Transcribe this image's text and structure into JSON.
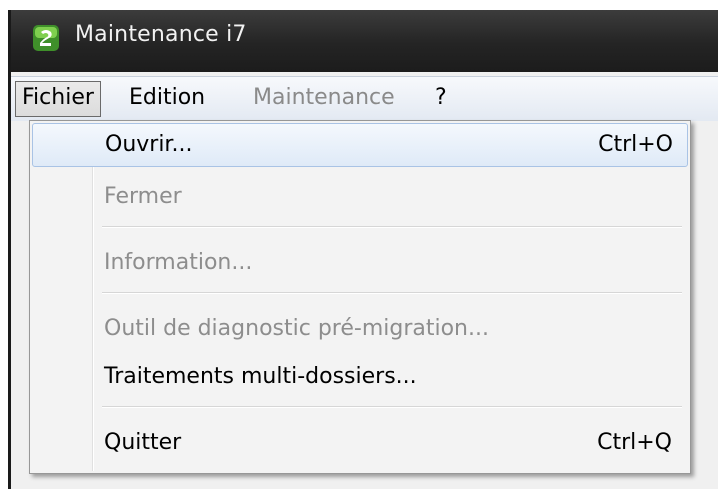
{
  "window": {
    "title": "Maintenance i7"
  },
  "menubar": {
    "items": [
      {
        "label": "Fichier"
      },
      {
        "label": "Edition"
      },
      {
        "label": "Maintenance"
      },
      {
        "label": "?"
      }
    ]
  },
  "file_menu": {
    "items": [
      {
        "label": "Ouvrir...",
        "shortcut": "Ctrl+O"
      },
      {
        "label": "Fermer"
      },
      {
        "label": "Information..."
      },
      {
        "label": "Outil de diagnostic pré-migration..."
      },
      {
        "label": "Traitements multi-dossiers..."
      },
      {
        "label": "Quitter",
        "shortcut": "Ctrl+Q"
      }
    ]
  },
  "icons": {
    "app": "app-icon"
  },
  "colors": {
    "titlebar": "#242424",
    "menu_highlight": "#dfeaf7",
    "disabled_text": "#8d8d8d"
  }
}
